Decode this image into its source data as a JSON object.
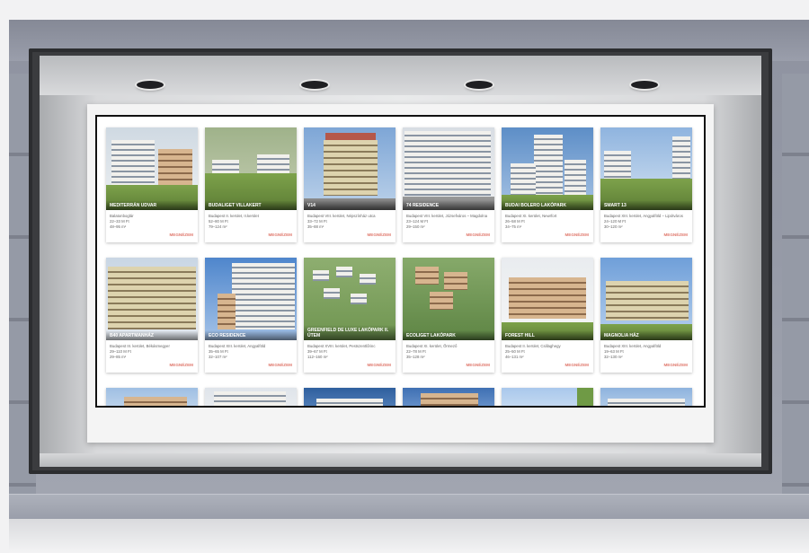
{
  "listings": [
    {
      "title": "MEDITERRÁN UDVAR",
      "lines": [
        "Balatonboglár",
        "22–33 M Ft",
        "48–95 m²"
      ],
      "cta": "MEGNÉZEM"
    },
    {
      "title": "BUDALIGET VILLAKERT",
      "lines": [
        "Budapest II. kerület, II.kerület",
        "52–80 M Ft",
        "79–124 m²"
      ],
      "cta": "MEGNÉZEM"
    },
    {
      "title": "V14",
      "lines": [
        "Budapest VIII. kerület, Népszínház utca",
        "33–72 M Ft",
        "35–88 m²"
      ],
      "cta": "MEGNÉZEM"
    },
    {
      "title": "74 RESIDENCE",
      "lines": [
        "Budapest VIII. kerület, Józsefváros – Magdolna",
        "23–124 M Ft",
        "29–150 m²"
      ],
      "cta": "MEGNÉZEM"
    },
    {
      "title": "BUDAI BOLERO LAKÓPARK",
      "lines": [
        "Budapest XI. kerület, Newrfort",
        "26–58 M Ft",
        "34–75 m²"
      ],
      "cta": "MEGNÉZEM"
    },
    {
      "title": "SMART 13",
      "lines": [
        "Budapest XIII. kerület, Angyalföld – Lipótváros",
        "24–120 M Ft",
        "30–120 m²"
      ],
      "cta": "MEGNÉZEM"
    },
    {
      "title": "B40 APARTMANHÁZ",
      "lines": [
        "Budapest III. kerület, Békásmegyer",
        "29–110 M Ft",
        "29–85 m²"
      ],
      "cta": "MEGNÉZEM"
    },
    {
      "title": "ECO RESIDENCE",
      "lines": [
        "Budapest XIII. kerület, Angyalföld",
        "35–65 M Ft",
        "32–107 m²"
      ],
      "cta": "MEGNÉZEM"
    },
    {
      "title": "GREENFIELD DE LUXE LAKÓPARK II. ÜTEM",
      "lines": [
        "Budapest XVIII. kerület, Pestszentlőrinc",
        "39–67 M Ft",
        "112–160 m²"
      ],
      "cta": "MEGNÉZEM"
    },
    {
      "title": "ECOLIGET LAKÓPARK",
      "lines": [
        "Budapest XI. kerület, Őrmező",
        "22–78 M Ft",
        "35–128 m²"
      ],
      "cta": "MEGNÉZEM"
    },
    {
      "title": "FOREST HILL",
      "lines": [
        "Budapest II. kerület, Csillaghegy",
        "25–50 M Ft",
        "46–131 m²"
      ],
      "cta": "MEGNÉZEM"
    },
    {
      "title": "MAGNOLIA HÁZ",
      "lines": [
        "Budapest XIII. kerület, Angyalföld",
        "19–63 M Ft",
        "32–130 m²"
      ],
      "cta": "MEGNÉZEM"
    }
  ],
  "colors": {
    "cta": "#e07a6e",
    "frame": "#3b3c3f",
    "facade": "#9599a6"
  }
}
